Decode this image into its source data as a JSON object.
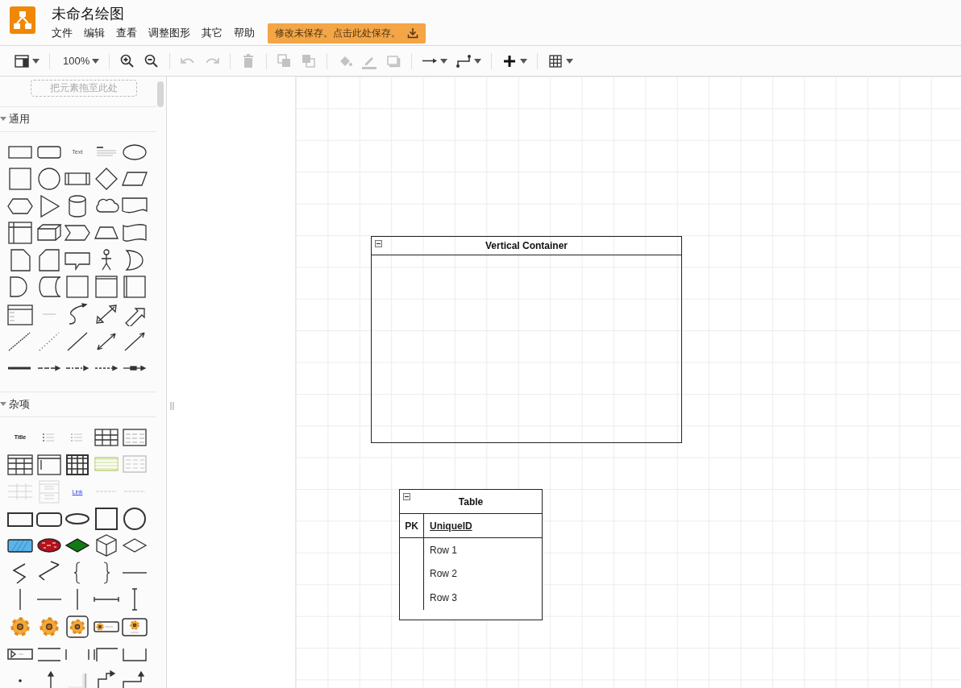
{
  "app": {
    "title": "未命名绘图",
    "save_notice": "修改未保存。点击此处保存。"
  },
  "menu": [
    "文件",
    "编辑",
    "查看",
    "调整图形",
    "其它",
    "帮助"
  ],
  "toolbar": [
    {
      "kind": "format-panel",
      "disabled": false,
      "dropdown": true
    },
    {
      "kind": "separator"
    },
    {
      "kind": "zoom",
      "label": "100%",
      "disabled": false,
      "dropdown": true
    },
    {
      "kind": "separator"
    },
    {
      "kind": "zoom-in",
      "disabled": false,
      "dropdown": false
    },
    {
      "kind": "zoom-out",
      "disabled": false,
      "dropdown": false
    },
    {
      "kind": "separator"
    },
    {
      "kind": "undo",
      "disabled": true,
      "dropdown": false
    },
    {
      "kind": "redo",
      "disabled": true,
      "dropdown": false
    },
    {
      "kind": "separator"
    },
    {
      "kind": "delete",
      "disabled": true,
      "dropdown": false
    },
    {
      "kind": "separator"
    },
    {
      "kind": "to-front",
      "disabled": true,
      "dropdown": false
    },
    {
      "kind": "to-back",
      "disabled": true,
      "dropdown": false
    },
    {
      "kind": "separator"
    },
    {
      "kind": "fill",
      "disabled": true,
      "dropdown": false
    },
    {
      "kind": "line-color",
      "disabled": true,
      "dropdown": false
    },
    {
      "kind": "shadow",
      "disabled": true,
      "dropdown": false
    },
    {
      "kind": "separator"
    },
    {
      "kind": "connection",
      "disabled": false,
      "dropdown": true
    },
    {
      "kind": "waypoints",
      "disabled": false,
      "dropdown": true
    },
    {
      "kind": "separator"
    },
    {
      "kind": "insert",
      "disabled": false,
      "dropdown": true
    },
    {
      "kind": "separator"
    },
    {
      "kind": "table",
      "disabled": false,
      "dropdown": true
    }
  ],
  "sidebar": {
    "dropzone": "把元素拖至此处",
    "sections": [
      {
        "title": "通用",
        "expanded": true,
        "shapes": [
          {
            "kind": "rect"
          },
          {
            "kind": "rounded"
          },
          {
            "kind": "label",
            "label": "Text"
          },
          {
            "kind": "textbox"
          },
          {
            "kind": "ellipse"
          },
          {
            "kind": "square"
          },
          {
            "kind": "circle"
          },
          {
            "kind": "process"
          },
          {
            "kind": "diamond"
          },
          {
            "kind": "parallelogram"
          },
          {
            "kind": "hexagon"
          },
          {
            "kind": "triangle"
          },
          {
            "kind": "cylinder"
          },
          {
            "kind": "cloud"
          },
          {
            "kind": "document"
          },
          {
            "kind": "internal-storage"
          },
          {
            "kind": "cube"
          },
          {
            "kind": "step"
          },
          {
            "kind": "trapezoid"
          },
          {
            "kind": "tape"
          },
          {
            "kind": "note"
          },
          {
            "kind": "card"
          },
          {
            "kind": "callout"
          },
          {
            "kind": "actor"
          },
          {
            "kind": "or"
          },
          {
            "kind": "delay"
          },
          {
            "kind": "data-storage"
          },
          {
            "kind": "square"
          },
          {
            "kind": "container-header"
          },
          {
            "kind": "container-side"
          },
          {
            "kind": "list"
          },
          {
            "kind": "list-item"
          },
          {
            "kind": "curve"
          },
          {
            "kind": "double-arrow"
          },
          {
            "kind": "block-arrow"
          },
          {
            "kind": "dashed-line"
          },
          {
            "kind": "dotted-line"
          },
          {
            "kind": "line"
          },
          {
            "kind": "bidir-line"
          },
          {
            "kind": "dir-line"
          },
          {
            "kind": "thick-line"
          },
          {
            "kind": "arrow-dashed"
          },
          {
            "kind": "arrow-dashdot"
          },
          {
            "kind": "arrow-shortdash"
          },
          {
            "kind": "arrow-block"
          }
        ]
      },
      {
        "title": "杂项",
        "expanded": true,
        "shapes": [
          {
            "kind": "label-bold",
            "label": "Title"
          },
          {
            "kind": "bullet-list"
          },
          {
            "kind": "numbered-list"
          },
          {
            "kind": "table-grid"
          },
          {
            "kind": "table-light"
          },
          {
            "kind": "table-header"
          },
          {
            "kind": "table-container"
          },
          {
            "kind": "table-dark"
          },
          {
            "kind": "table-green"
          },
          {
            "kind": "table-gray"
          },
          {
            "kind": "table-faint"
          },
          {
            "kind": "list-panel"
          },
          {
            "kind": "label-link",
            "label": "Link"
          },
          {
            "kind": "text-faint"
          },
          {
            "kind": "text-faint"
          },
          {
            "kind": "sketch-rect"
          },
          {
            "kind": "sketch-rounded"
          },
          {
            "kind": "sketch-ellipse"
          },
          {
            "kind": "sketch-square"
          },
          {
            "kind": "sketch-circle"
          },
          {
            "kind": "hatch-rect"
          },
          {
            "kind": "hatch-ellipse"
          },
          {
            "kind": "green-diamond"
          },
          {
            "kind": "iso-cube"
          },
          {
            "kind": "flat-diamond"
          },
          {
            "kind": "zigzag"
          },
          {
            "kind": "zigzag-wide"
          },
          {
            "kind": "brace-left"
          },
          {
            "kind": "brace-right"
          },
          {
            "kind": "hline"
          },
          {
            "kind": "vline"
          },
          {
            "kind": "hline"
          },
          {
            "kind": "vline"
          },
          {
            "kind": "dim-h"
          },
          {
            "kind": "dim-v"
          },
          {
            "kind": "gear"
          },
          {
            "kind": "gear"
          },
          {
            "kind": "gear-framed"
          },
          {
            "kind": "gear-label"
          },
          {
            "kind": "gear-card"
          },
          {
            "kind": "play-label"
          },
          {
            "kind": "double-hline"
          },
          {
            "kind": "vline-pair"
          },
          {
            "kind": "corner"
          },
          {
            "kind": "u-shape"
          },
          {
            "kind": "dot"
          },
          {
            "kind": "elbow-arrow"
          },
          {
            "kind": "shadow-corner"
          },
          {
            "kind": "step-arrow"
          },
          {
            "kind": "step-arrow-wide"
          }
        ]
      }
    ]
  },
  "diagram": [
    {
      "kind": "container",
      "title": "Vertical Container"
    },
    {
      "kind": "table",
      "title": "Table",
      "key": "PK",
      "key_field": "UniqueID",
      "rows": [
        "Row 1",
        "Row 2",
        "Row 3"
      ]
    }
  ]
}
